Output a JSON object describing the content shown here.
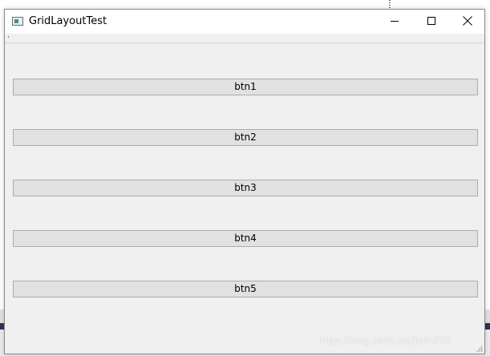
{
  "window": {
    "title": "GridLayoutTest"
  },
  "buttons": [
    {
      "label": "btn1"
    },
    {
      "label": "btn2"
    },
    {
      "label": "btn3"
    },
    {
      "label": "btn4"
    },
    {
      "label": "btn5"
    }
  ],
  "watermark": "https://blog.csdn.net/jolin678",
  "colors": {
    "window_bg": "#f0f0f0",
    "titlebar_bg": "#ffffff",
    "button_bg": "#e1e1e1",
    "button_border": "#adadad"
  },
  "icons": {
    "app": "app-window-icon",
    "minimize": "minimize-icon",
    "maximize": "maximize-icon",
    "close": "close-icon"
  }
}
